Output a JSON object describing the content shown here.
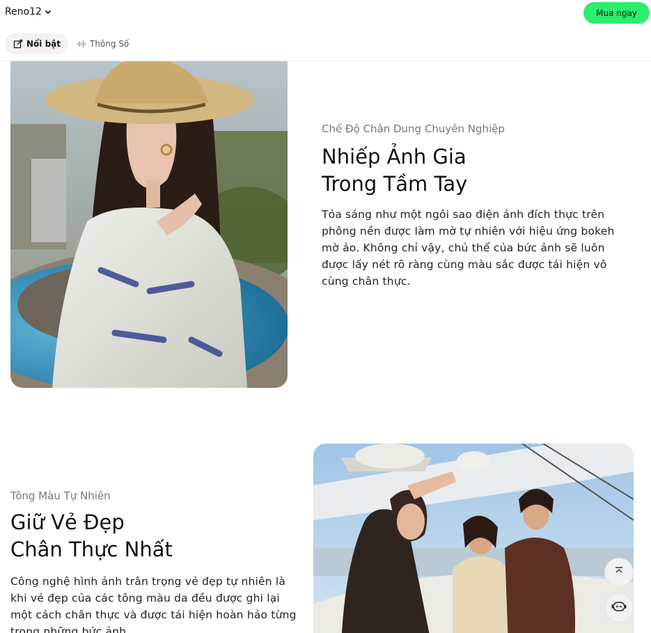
{
  "header": {
    "product_name": "Reno12",
    "product_chevron_icon": "chevron-down-icon",
    "buy_label": "Mua ngay",
    "buy_color": "#2bee6c"
  },
  "subnav": {
    "tabs": [
      {
        "label": "Nổi bật",
        "icon": "highlight-icon",
        "active": true
      },
      {
        "label": "Thông Số",
        "icon": "spec-waveform-icon",
        "active": false
      }
    ]
  },
  "sections": [
    {
      "eyebrow": "Chế Độ Chân Dung Chuyên Nghiệp",
      "headline_line1": "Nhiếp Ảnh Gia",
      "headline_line2": "Trong Tầm Tay",
      "body": "Tỏa sáng như một ngôi sao điện ảnh đích thực trên phông nền được làm mờ tự nhiên với hiệu ứng bokeh mờ ảo. Không chỉ vậy, chủ thể của bức ảnh sẽ luôn được lấy nét rõ ràng cùng màu sắc được tái hiện vô cùng chân thực.",
      "image": "portrait-photo-woman-straw-hat-fountain"
    },
    {
      "eyebrow": "Tông Màu Tự Nhiên",
      "headline_line1": "Giữ Vẻ Đẹp",
      "headline_line2": "Chân Thực Nhất",
      "body": "Công nghệ hình ảnh trân trọng vẻ đẹp tự nhiên là khi vẻ đẹp của các tông màu da đều được ghi lại một cách chân thực và được tái hiện hoàn hảo từng trong những bức ảnh.",
      "image": "group-photo-friends-on-boat"
    }
  ],
  "floating": {
    "top_icon": "scroll-to-top-icon",
    "chat_icon": "chat-assistant-icon"
  }
}
